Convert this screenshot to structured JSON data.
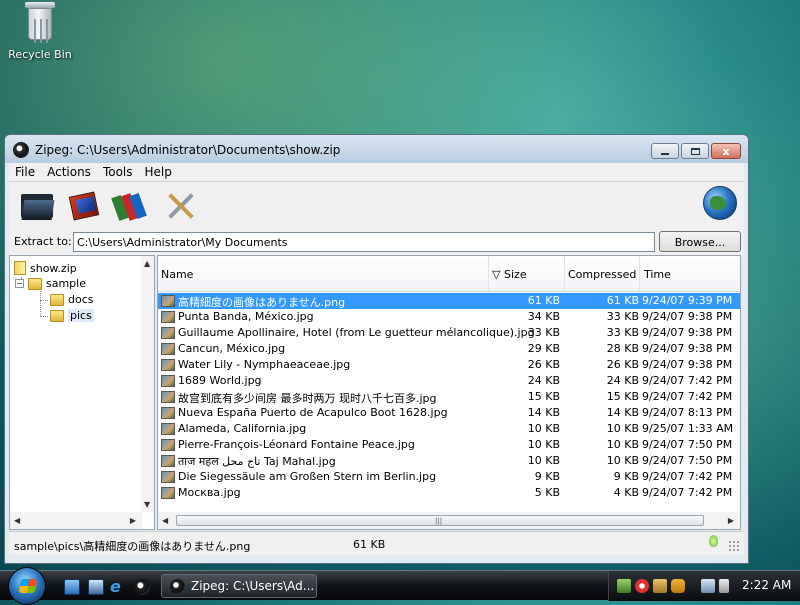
{
  "desktop": {
    "recycle_bin_label": "Recycle Bin"
  },
  "window": {
    "title": "Zipeg: C:\\Users\\Administrator\\Documents\\show.zip",
    "close_glyph": "x"
  },
  "menu": [
    "File",
    "Actions",
    "Tools",
    "Help"
  ],
  "toolbar": {
    "icons": [
      "open-folder-icon",
      "extract-book-icon",
      "books-icon",
      "tools-icon",
      "globe-icon"
    ]
  },
  "extract": {
    "label": "Extract to:",
    "value": "C:\\Users\\Administrator\\My Documents",
    "browse_label": "Browse..."
  },
  "tree": {
    "root": "show.zip",
    "child": "sample",
    "leaves": [
      "docs",
      "pics"
    ],
    "expander_glyph": "−"
  },
  "list": {
    "headers": {
      "name": "Name",
      "size": "Size",
      "compressed": "Compressed",
      "time": "Time"
    },
    "sort_glyph": "▽",
    "rows": [
      {
        "name": "高精細度の画像はありません.png",
        "size": "61 KB",
        "compressed": "61 KB",
        "time": "9/24/07 9:39 PM",
        "selected": true
      },
      {
        "name": "Punta Banda, México.jpg",
        "size": "34 KB",
        "compressed": "33 KB",
        "time": "9/24/07 9:38 PM"
      },
      {
        "name": "Guillaume Apollinaire, Hotel (from Le guetteur mélancolique).jpg",
        "size": "33 KB",
        "compressed": "33 KB",
        "time": "9/24/07 9:38 PM"
      },
      {
        "name": "Cancun, México.jpg",
        "size": "29 KB",
        "compressed": "28 KB",
        "time": "9/24/07 9:38 PM"
      },
      {
        "name": "Water Lily - Nymphaeaceae.jpg",
        "size": "26 KB",
        "compressed": "26 KB",
        "time": "9/24/07 9:38 PM"
      },
      {
        "name": "1689 World.jpg",
        "size": "24 KB",
        "compressed": "24 KB",
        "time": "9/24/07 7:42 PM"
      },
      {
        "name": "故宫到底有多少间房 最多时两万 现时八千七百多.jpg",
        "size": "15 KB",
        "compressed": "15 KB",
        "time": "9/24/07 7:42 PM"
      },
      {
        "name": "Nueva España Puerto de Acapulco Boot 1628.jpg",
        "size": "14 KB",
        "compressed": "14 KB",
        "time": "9/24/07 8:13 PM"
      },
      {
        "name": "Alameda, California.jpg",
        "size": "10 KB",
        "compressed": "10 KB",
        "time": "9/25/07 1:33 AM"
      },
      {
        "name": "Pierre-François-Léonard Fontaine Peace.jpg",
        "size": "10 KB",
        "compressed": "10 KB",
        "time": "9/24/07 7:50 PM"
      },
      {
        "name": "ताज महल تاج محل Taj Mahal.jpg",
        "size": "10 KB",
        "compressed": "10 KB",
        "time": "9/24/07 7:50 PM"
      },
      {
        "name": "Die Siegessäule am Großen Stern im Berlin.jpg",
        "size": "9 KB",
        "compressed": "9 KB",
        "time": "9/24/07 7:42 PM"
      },
      {
        "name": "Москва.jpg",
        "size": "5 KB",
        "compressed": "4 KB",
        "time": "9/24/07 7:42 PM"
      }
    ],
    "scroll_grip": "|||"
  },
  "status": {
    "path": "sample\\pics\\高精細度の画像はありません.png",
    "size": "61 KB"
  },
  "taskbar": {
    "task_label": "Zipeg: C:\\Users\\Ad...",
    "ie_glyph": "e",
    "clock": "2:22 AM"
  },
  "colors": {
    "selection": "#3399ff",
    "window_frame": "#b9cce0"
  }
}
